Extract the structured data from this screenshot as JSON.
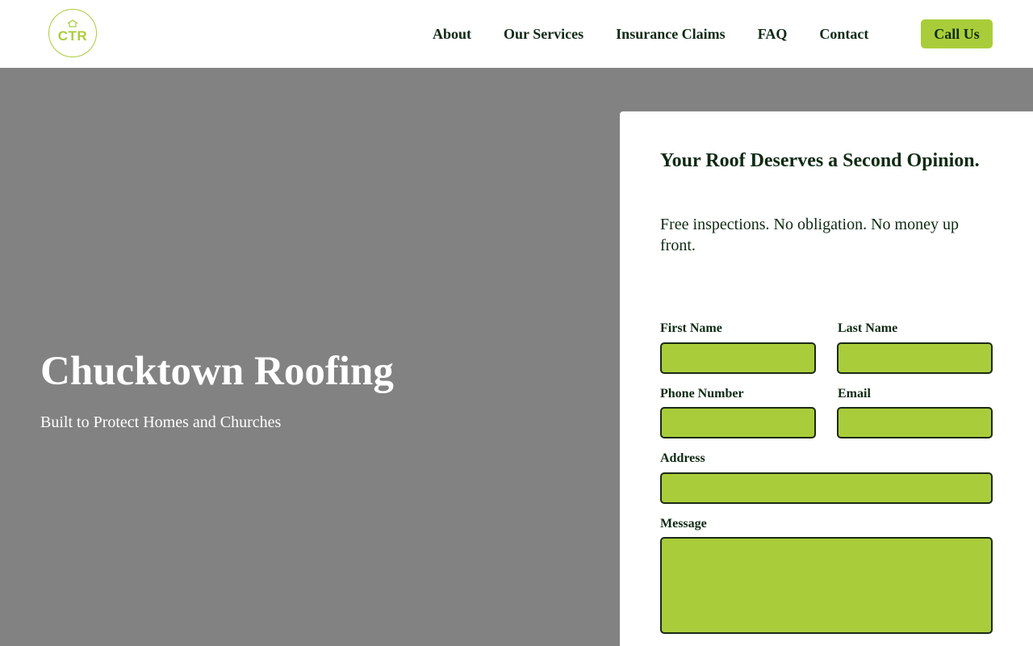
{
  "header": {
    "logo_text": "CTR",
    "nav": [
      "About",
      "Our Services",
      "Insurance Claims",
      "FAQ",
      "Contact"
    ],
    "call_button": "Call Us"
  },
  "hero": {
    "title": "Chucktown Roofing",
    "subtitle": "Built to Protect Homes and Churches"
  },
  "form": {
    "heading": "Your Roof Deserves a Second Opinion.",
    "intro": "Free inspections. No obligation. No money up front.",
    "first_name_label": "First Name",
    "last_name_label": "Last Name",
    "phone_label": "Phone Number",
    "email_label": "Email",
    "address_label": "Address",
    "message_label": "Message",
    "first_name_value": "",
    "last_name_value": "",
    "phone_value": "",
    "email_value": "",
    "address_value": "",
    "message_value": ""
  },
  "colors": {
    "accent": "#a9cd3a",
    "text_dark": "#0f2a14",
    "hero_bg": "#828282"
  },
  "icons": {
    "logo_house": "house-icon"
  }
}
